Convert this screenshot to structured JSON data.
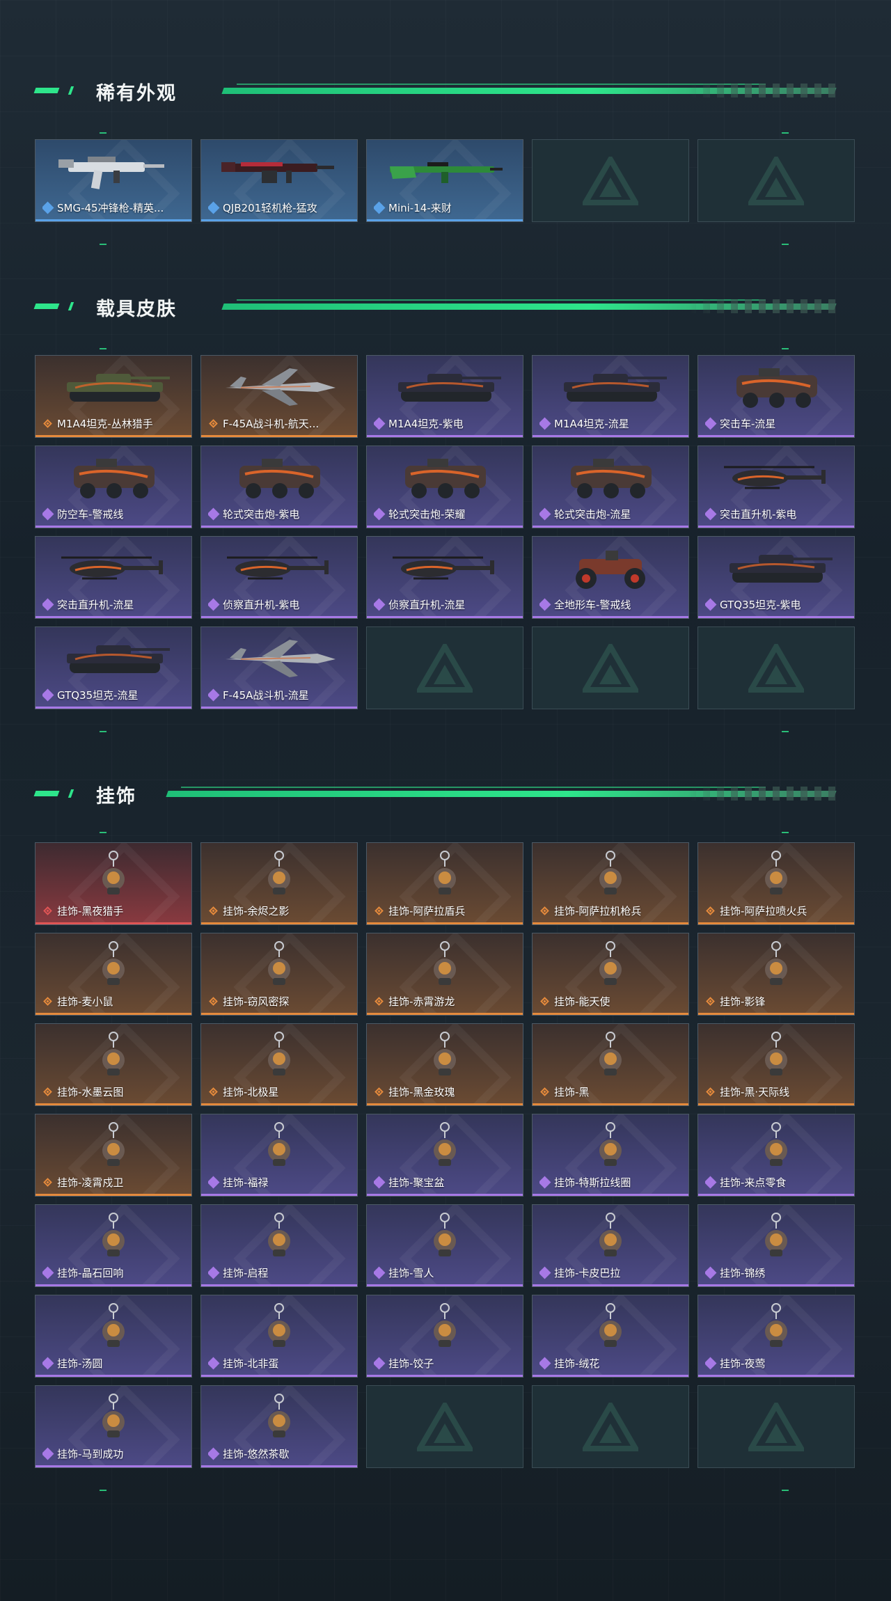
{
  "colors": {
    "accent": "#2ee58b",
    "blue_rarity": "#5aa2e8",
    "orange_rarity": "#e58a3c",
    "purple_rarity": "#a779e6",
    "red_rarity": "#e05555"
  },
  "sections": [
    {
      "title": "稀有外观",
      "items": [
        {
          "name": "SMG-45冲锋枪-精英...",
          "rarity": "blue",
          "icon": "smg-icon"
        },
        {
          "name": "QJB201轻机枪-猛攻",
          "rarity": "blue",
          "icon": "lmg-icon"
        },
        {
          "name": "Mini-14-来财",
          "rarity": "blue",
          "icon": "rifle-icon"
        },
        {
          "name": "",
          "rarity": "empty",
          "icon": "empty-slot-logo"
        },
        {
          "name": "",
          "rarity": "empty",
          "icon": "empty-slot-logo"
        }
      ]
    },
    {
      "title": "载具皮肤",
      "items": [
        {
          "name": "M1A4坦克-丛林猎手",
          "rarity": "orange",
          "icon": "tank-icon"
        },
        {
          "name": "F-45A战斗机-航天...",
          "rarity": "orange",
          "icon": "jet-icon"
        },
        {
          "name": "M1A4坦克-紫电",
          "rarity": "purple",
          "icon": "tank-icon"
        },
        {
          "name": "M1A4坦克-流星",
          "rarity": "purple",
          "icon": "tank-icon"
        },
        {
          "name": "突击车-流星",
          "rarity": "purple",
          "icon": "armored-car-icon"
        },
        {
          "name": "防空车-警戒线",
          "rarity": "purple",
          "icon": "armored-car-icon"
        },
        {
          "name": "轮式突击炮-紫电",
          "rarity": "purple",
          "icon": "armored-car-icon"
        },
        {
          "name": "轮式突击炮-荣耀",
          "rarity": "purple",
          "icon": "armored-car-icon"
        },
        {
          "name": "轮式突击炮-流星",
          "rarity": "purple",
          "icon": "armored-car-icon"
        },
        {
          "name": "突击直升机-紫电",
          "rarity": "purple",
          "icon": "helicopter-icon"
        },
        {
          "name": "突击直升机-流星",
          "rarity": "purple",
          "icon": "helicopter-icon"
        },
        {
          "name": "侦察直升机-紫电",
          "rarity": "purple",
          "icon": "helicopter-icon"
        },
        {
          "name": "侦察直升机-流星",
          "rarity": "purple",
          "icon": "helicopter-icon"
        },
        {
          "name": "全地形车-警戒线",
          "rarity": "purple",
          "icon": "atv-icon"
        },
        {
          "name": "GTQ35坦克-紫电",
          "rarity": "purple",
          "icon": "tank-icon"
        },
        {
          "name": "GTQ35坦克-流星",
          "rarity": "purple",
          "icon": "tank-icon"
        },
        {
          "name": "F-45A战斗机-流星",
          "rarity": "purple",
          "icon": "jet-icon"
        },
        {
          "name": "",
          "rarity": "empty",
          "icon": "empty-slot-logo"
        },
        {
          "name": "",
          "rarity": "empty",
          "icon": "empty-slot-logo"
        },
        {
          "name": "",
          "rarity": "empty",
          "icon": "empty-slot-logo"
        }
      ]
    },
    {
      "title": "挂饰",
      "items": [
        {
          "name": "挂饰-黑夜猎手",
          "rarity": "red",
          "icon": "charm-icon"
        },
        {
          "name": "挂饰-余烬之影",
          "rarity": "orange",
          "icon": "charm-icon"
        },
        {
          "name": "挂饰-阿萨拉盾兵",
          "rarity": "orange",
          "icon": "charm-icon"
        },
        {
          "name": "挂饰-阿萨拉机枪兵",
          "rarity": "orange",
          "icon": "charm-icon"
        },
        {
          "name": "挂饰-阿萨拉喷火兵",
          "rarity": "orange",
          "icon": "charm-icon"
        },
        {
          "name": "挂饰-麦小鼠",
          "rarity": "orange",
          "icon": "charm-icon"
        },
        {
          "name": "挂饰-窃风密探",
          "rarity": "orange",
          "icon": "charm-icon"
        },
        {
          "name": "挂饰-赤霄游龙",
          "rarity": "orange",
          "icon": "charm-icon"
        },
        {
          "name": "挂饰-能天使",
          "rarity": "orange",
          "icon": "charm-icon"
        },
        {
          "name": "挂饰-影锋",
          "rarity": "orange",
          "icon": "charm-icon"
        },
        {
          "name": "挂饰-水墨云图",
          "rarity": "orange",
          "icon": "charm-icon"
        },
        {
          "name": "挂饰-北极星",
          "rarity": "orange",
          "icon": "charm-icon"
        },
        {
          "name": "挂饰-黑金玫瑰",
          "rarity": "orange",
          "icon": "charm-icon"
        },
        {
          "name": "挂饰-黑",
          "rarity": "orange",
          "icon": "charm-icon"
        },
        {
          "name": "挂饰-黑·天际线",
          "rarity": "orange",
          "icon": "charm-icon"
        },
        {
          "name": "挂饰-凌霄戍卫",
          "rarity": "orange",
          "icon": "charm-icon"
        },
        {
          "name": "挂饰-福禄",
          "rarity": "purple",
          "icon": "charm-icon"
        },
        {
          "name": "挂饰-聚宝盆",
          "rarity": "purple",
          "icon": "charm-icon"
        },
        {
          "name": "挂饰-特斯拉线圈",
          "rarity": "purple",
          "icon": "charm-icon"
        },
        {
          "name": "挂饰-来点零食",
          "rarity": "purple",
          "icon": "charm-icon"
        },
        {
          "name": "挂饰-晶石回响",
          "rarity": "purple",
          "icon": "charm-icon"
        },
        {
          "name": "挂饰-启程",
          "rarity": "purple",
          "icon": "charm-icon"
        },
        {
          "name": "挂饰-雪人",
          "rarity": "purple",
          "icon": "charm-icon"
        },
        {
          "name": "挂饰-卡皮巴拉",
          "rarity": "purple",
          "icon": "charm-icon"
        },
        {
          "name": "挂饰-锦绣",
          "rarity": "purple",
          "icon": "charm-icon"
        },
        {
          "name": "挂饰-汤圆",
          "rarity": "purple",
          "icon": "charm-icon"
        },
        {
          "name": "挂饰-北非蛋",
          "rarity": "purple",
          "icon": "charm-icon"
        },
        {
          "name": "挂饰-饺子",
          "rarity": "purple",
          "icon": "charm-icon"
        },
        {
          "name": "挂饰-绒花",
          "rarity": "purple",
          "icon": "charm-icon"
        },
        {
          "name": "挂饰-夜莺",
          "rarity": "purple",
          "icon": "charm-icon"
        },
        {
          "name": "挂饰-马到成功",
          "rarity": "purple",
          "icon": "charm-icon"
        },
        {
          "name": "挂饰-悠然茶歇",
          "rarity": "purple",
          "icon": "charm-icon"
        },
        {
          "name": "",
          "rarity": "empty",
          "icon": "empty-slot-logo"
        },
        {
          "name": "",
          "rarity": "empty",
          "icon": "empty-slot-logo"
        },
        {
          "name": "",
          "rarity": "empty",
          "icon": "empty-slot-logo"
        }
      ]
    }
  ]
}
